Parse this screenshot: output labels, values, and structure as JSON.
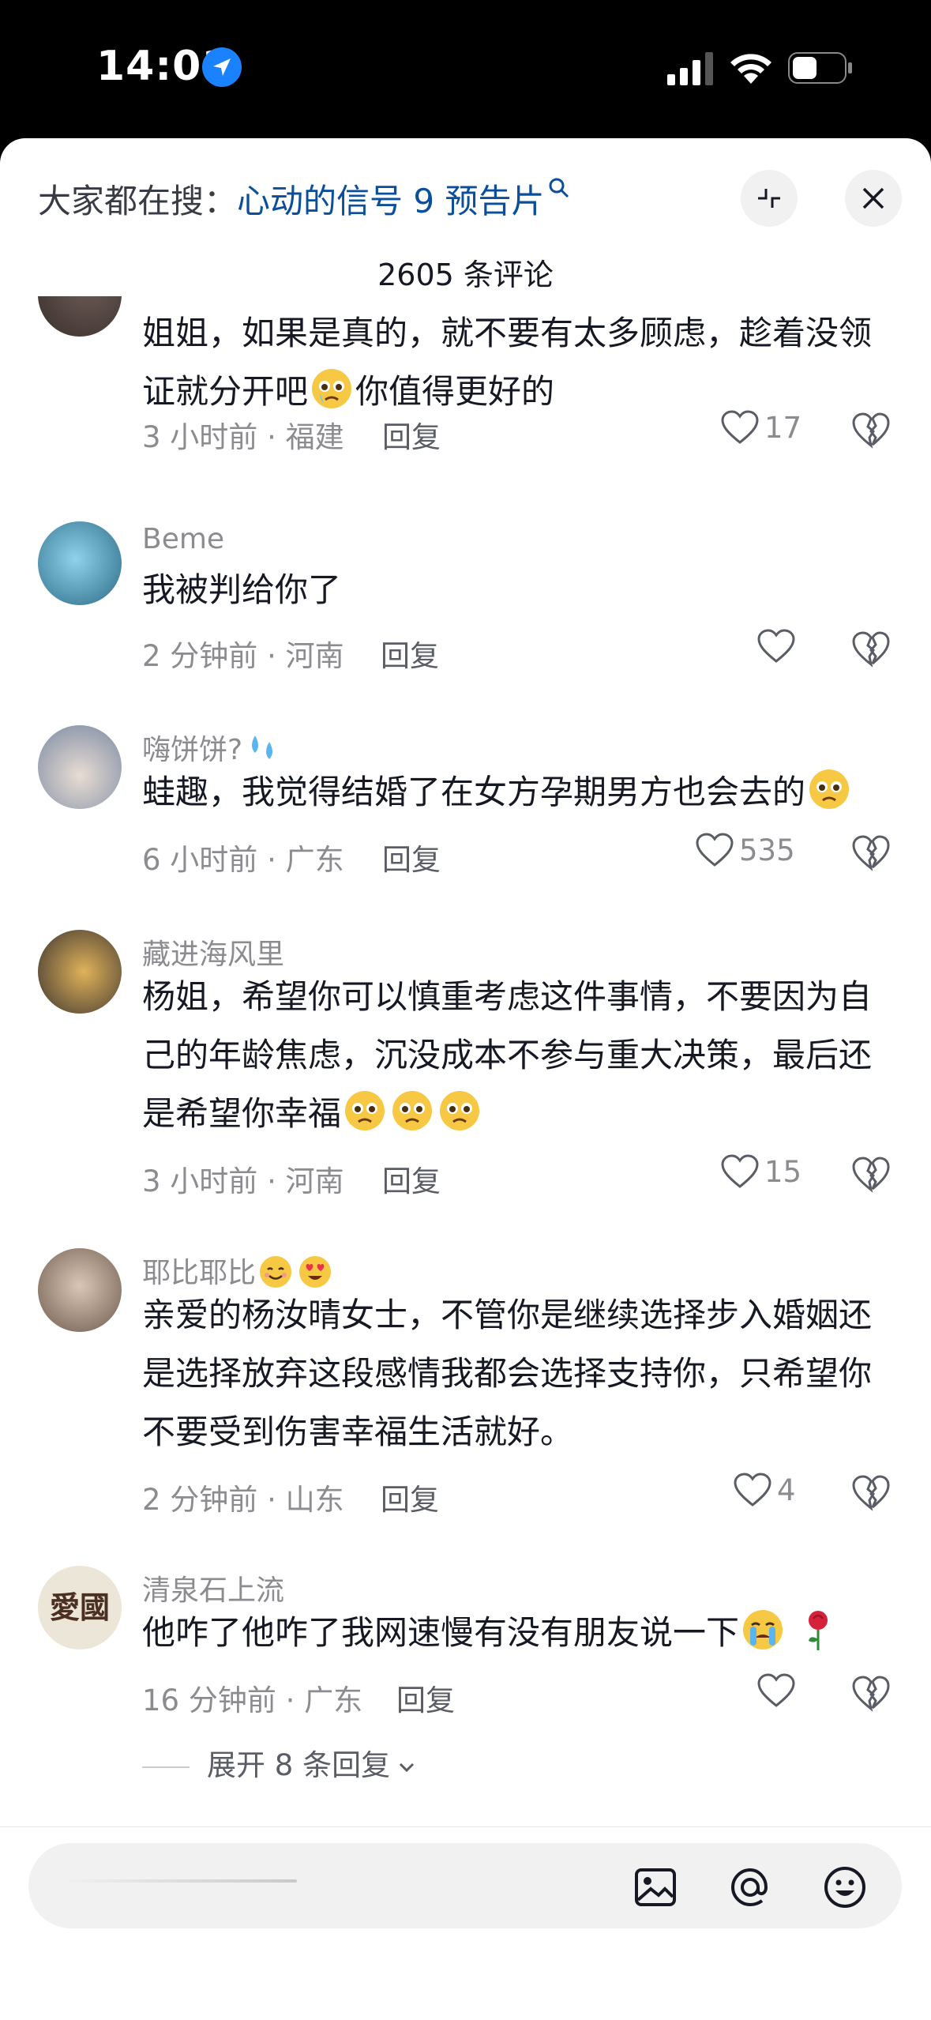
{
  "status_bar": {
    "time": "14:01"
  },
  "header": {
    "search_prefix": "大家都在搜：",
    "search_term": "心动的信号 9 预告片",
    "comment_count": "2605 条评论"
  },
  "comments": [
    {
      "username": "",
      "text_before": "姐姐，如果是真的，就不要有太多顾虑，趁着没领证就分开吧",
      "text_after": "你值得更好的",
      "meta": "3 小时前 · 福建",
      "reply": "回复",
      "likes": "17"
    },
    {
      "username": "Beme",
      "text": "我被判给你了",
      "meta": "2 分钟前 · 河南",
      "reply": "回复",
      "likes": ""
    },
    {
      "username": "嗨饼饼?",
      "text": "蛙趣，我觉得结婚了在女方孕期男方也会去的",
      "meta": "6 小时前 · 广东",
      "reply": "回复",
      "likes": "535"
    },
    {
      "username": "藏进海风里",
      "text": "杨姐，希望你可以慎重考虑这件事情，不要因为自己的年龄焦虑，沉没成本不参与重大决策，最后还是希望你幸福",
      "meta": "3 小时前 · 河南",
      "reply": "回复",
      "likes": "15"
    },
    {
      "username": "耶比耶比",
      "text": "亲爱的杨汝晴女士，不管你是继续选择步入婚姻还是选择放弃这段感情我都会选择支持你，只希望你不要受到伤害幸福生活就好。",
      "meta": "2 分钟前 · 山东",
      "reply": "回复",
      "likes": "4"
    },
    {
      "username": "清泉石上流",
      "text": "他咋了他咋了我网速慢有没有朋友说一下",
      "meta": "16 分钟前 · 广东",
      "reply": "回复",
      "likes": "",
      "expand": "展开 8 条回复",
      "avatar_text": "愛國"
    }
  ],
  "colors": {
    "accent_link": "#0b4f9c",
    "meta_gray": "#8b8b90",
    "text": "#161823"
  },
  "icons": [
    "location-arrow-icon",
    "signal-icon",
    "wifi-icon",
    "battery-icon",
    "collapse-icon",
    "close-icon",
    "heart-icon",
    "dislike-heart-icon",
    "image-icon",
    "at-icon",
    "emoji-icon"
  ]
}
